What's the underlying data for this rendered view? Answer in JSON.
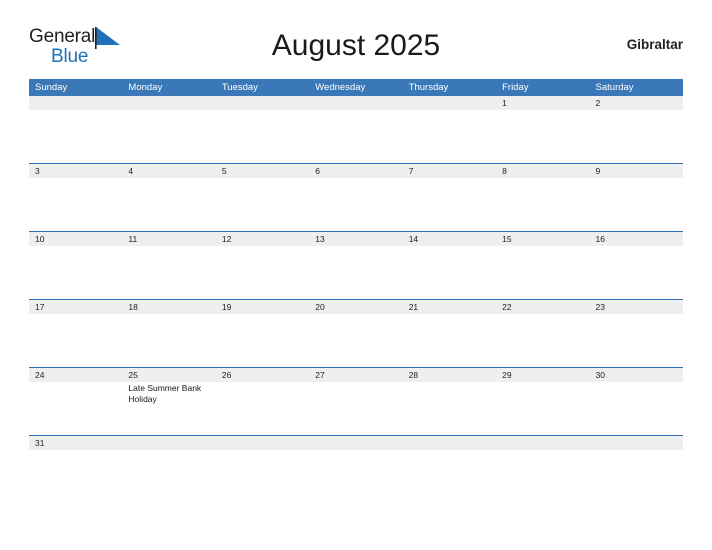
{
  "brand": {
    "name_part1": "General",
    "name_part2": "Blue",
    "flag_icon": "blue-triangle-flag",
    "color_dark": "#231f20",
    "color_blue": "#1f72b8"
  },
  "header": {
    "title": "August 2025",
    "region": "Gibraltar"
  },
  "theme": {
    "header_blue": "#3b78b8",
    "row_divider_blue": "#2c6cb0",
    "date_band_gray": "#efefef",
    "text_dark": "#222222"
  },
  "calendar": {
    "month": "August",
    "year": "2025",
    "weekday_headers": [
      "Sunday",
      "Monday",
      "Tuesday",
      "Wednesday",
      "Thursday",
      "Friday",
      "Saturday"
    ],
    "weeks": [
      {
        "dates": [
          "",
          "",
          "",
          "",
          "",
          "1",
          "2"
        ],
        "events": [
          "",
          "",
          "",
          "",
          "",
          "",
          ""
        ]
      },
      {
        "dates": [
          "3",
          "4",
          "5",
          "6",
          "7",
          "8",
          "9"
        ],
        "events": [
          "",
          "",
          "",
          "",
          "",
          "",
          ""
        ]
      },
      {
        "dates": [
          "10",
          "11",
          "12",
          "13",
          "14",
          "15",
          "16"
        ],
        "events": [
          "",
          "",
          "",
          "",
          "",
          "",
          ""
        ]
      },
      {
        "dates": [
          "17",
          "18",
          "19",
          "20",
          "21",
          "22",
          "23"
        ],
        "events": [
          "",
          "",
          "",
          "",
          "",
          "",
          ""
        ]
      },
      {
        "dates": [
          "24",
          "25",
          "26",
          "27",
          "28",
          "29",
          "30"
        ],
        "events": [
          "",
          "Late Summer Bank Holiday",
          "",
          "",
          "",
          "",
          ""
        ]
      },
      {
        "dates": [
          "31",
          "",
          "",
          "",
          "",
          "",
          ""
        ],
        "events": [
          "",
          "",
          "",
          "",
          "",
          "",
          ""
        ]
      }
    ]
  }
}
